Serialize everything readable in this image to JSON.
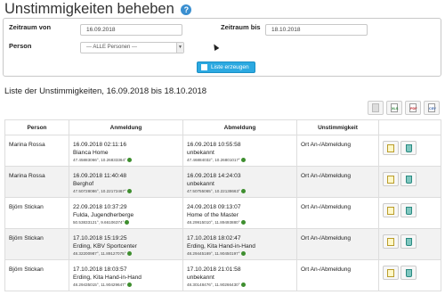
{
  "page": {
    "title": "Unstimmigkeiten beheben",
    "help_icon": "?"
  },
  "filter": {
    "from_label": "Zeitraum von",
    "from_value": "16.09.2018",
    "to_label": "Zeitraum bis",
    "to_value": "18.10.2018",
    "person_label": "Person",
    "person_value": "--- ALLE Personen ---",
    "submit_label": "Liste erzeugen"
  },
  "list": {
    "title": "Liste der Unstimmigkeiten, 16.09.2018 bis 18.10.2018",
    "export_xls": "XLS",
    "export_pdf": "PDF",
    "export_csv": "CSV",
    "columns": [
      "Person",
      "Anmeldung",
      "Abmeldung",
      "Unstimmigkeit",
      ""
    ],
    "rows": [
      {
        "person": "Marina Rossa",
        "in_time": "16.09.2018 02:11:16",
        "in_place": "Bianca Home",
        "in_coords": "47.45883066°, 10.26833364°",
        "out_time": "16.09.2018 10:55:58",
        "out_place": "unbekannt",
        "out_coords": "47.46884032°, 10.26801017°",
        "issue": "Ort An-/Abmeldung"
      },
      {
        "person": "Marina Rossa",
        "in_time": "16.09.2018 11:40:48",
        "in_place": "Berghof",
        "in_coords": "47.50728086°, 10.22172467°",
        "out_time": "16.09.2018 14:24:03",
        "out_place": "unbekannt",
        "out_coords": "47.50755065°, 10.22138663°",
        "issue": "Ort An-/Abmeldung"
      },
      {
        "person": "Björn Stickan",
        "in_time": "22.09.2018 10:37:29",
        "in_place": "Fulda, Jugendherberge",
        "in_coords": "50.53833121°, 9.66106374°",
        "out_time": "24.09.2018 09:13:07",
        "out_place": "Home of the Master",
        "out_coords": "48.29915010°, 11.89493880°",
        "issue": "Ort An-/Abmeldung"
      },
      {
        "person": "Björn Stickan",
        "in_time": "17.10.2018 15:19:25",
        "in_place": "Erding, KBV Sportcenter",
        "in_coords": "48.32200987°, 11.89127075°",
        "out_time": "17.10.2018 18:02:47",
        "out_place": "Erding, Kita Hand-in-Hand",
        "out_coords": "48.29445169°, 11.90450197°",
        "issue": "Ort An-/Abmeldung"
      },
      {
        "person": "Björn Stickan",
        "in_time": "17.10.2018 18:03:57",
        "in_place": "Erding, Kita Hand-in-Hand",
        "in_coords": "48.29435015°, 11.90429647°",
        "out_time": "17.10.2018 21:01:58",
        "out_place": "unbekannt",
        "out_coords": "48.30148476°, 11.90266430°",
        "issue": "Ort An-/Abmeldung"
      }
    ]
  }
}
